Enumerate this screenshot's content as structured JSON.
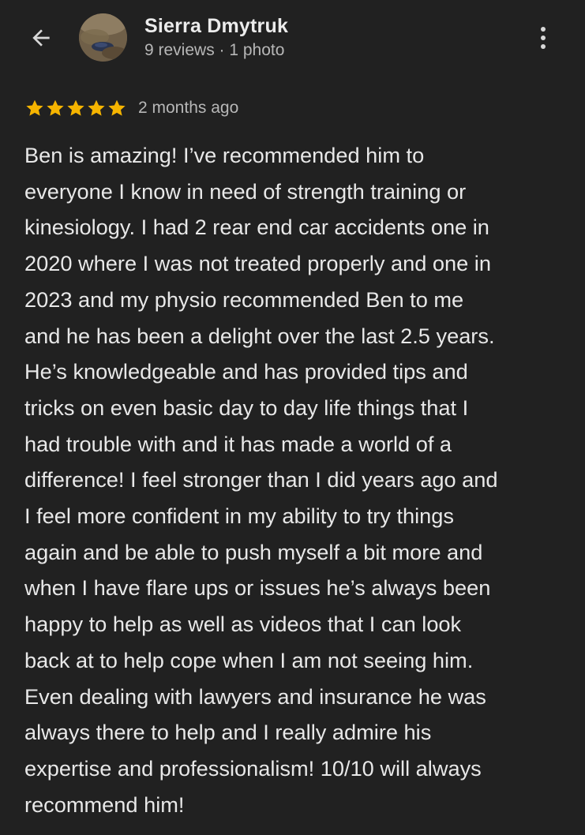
{
  "header": {
    "back_icon": "arrow-left-icon",
    "user_name": "Sierra Dmytruk",
    "user_meta": "9 reviews · 1 photo",
    "more_icon": "more-vertical-icon"
  },
  "review": {
    "rating": 5,
    "rating_max": 5,
    "star_color": "#f5b400",
    "time_ago": "2 months ago",
    "lines": [
      "Ben is amazing! I’ve recommended him to",
      "everyone I know in need of strength training or",
      "kinesiology. I had 2 rear end car accidents one in",
      "2020 where I was not treated properly and one in",
      "2023 and my physio recommended Ben to me",
      "and he has been a delight over the last 2.5 years.",
      "He’s knowledgeable and has provided tips and",
      "tricks on even basic day to day life things that I",
      "had trouble with and it has made a world of a",
      "difference! I feel stronger than I did years ago and",
      "I feel more confident in my ability to try things",
      "again and be able to push myself a bit more and",
      "when I have flare ups or issues he’s always been",
      "happy to help as well as videos that I can look",
      "back at to help cope when I am not seeing him.",
      "Even dealing with lawyers and insurance he was",
      "always there to help and I really admire his",
      "expertise and professionalism! 10/10 will always",
      "recommend him!"
    ]
  },
  "colors": {
    "background": "#212121",
    "text_primary": "#e8e8e8",
    "text_secondary": "#b7b7b7"
  }
}
